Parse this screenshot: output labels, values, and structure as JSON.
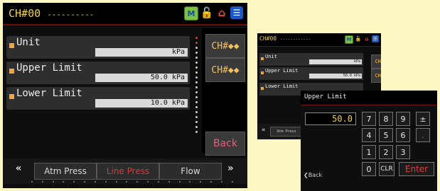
{
  "main": {
    "title": "CH#00",
    "title_dashes": "----------",
    "fields": [
      {
        "label": "Unit",
        "value": "kPa"
      },
      {
        "label": "Upper Limit",
        "value": "50.0 kPa"
      },
      {
        "label": "Lower Limit",
        "value": "10.0 kPa"
      }
    ],
    "side_buttons": [
      "CH#◆◆",
      "CH#◆◆"
    ],
    "back_label": "Back",
    "tabs": [
      "Atm Press",
      "Line Press",
      "Flow"
    ],
    "active_tab": "Line Press",
    "prev_arrow": "«",
    "next_arrow": "»"
  },
  "small_screen": {
    "title": "CH#00",
    "title_dashes": "------------",
    "fields": [
      {
        "label": "Unit",
        "value": "kPa"
      },
      {
        "label": "Upper Limit",
        "value": "50.0 kPa"
      },
      {
        "label": "Lower Limit",
        "value": ""
      }
    ],
    "side_buttons": [
      "CH#◆◆",
      "CH#◆◆"
    ],
    "tab": "Atm Press"
  },
  "keypad": {
    "title": "Upper Limit",
    "value": "50.0",
    "keys": [
      "7",
      "8",
      "9",
      "±",
      "4",
      "5",
      "6",
      ".",
      "1",
      "2",
      "3",
      "",
      "0",
      "CLR",
      "Enter"
    ],
    "back_label": "Back"
  },
  "icons": [
    "m-icon",
    "lock-icon",
    "home-icon",
    "document-icon"
  ],
  "colors": {
    "title": "#f2d24a",
    "accent_red": "#d83a3a",
    "background": "#fdf8c3"
  }
}
